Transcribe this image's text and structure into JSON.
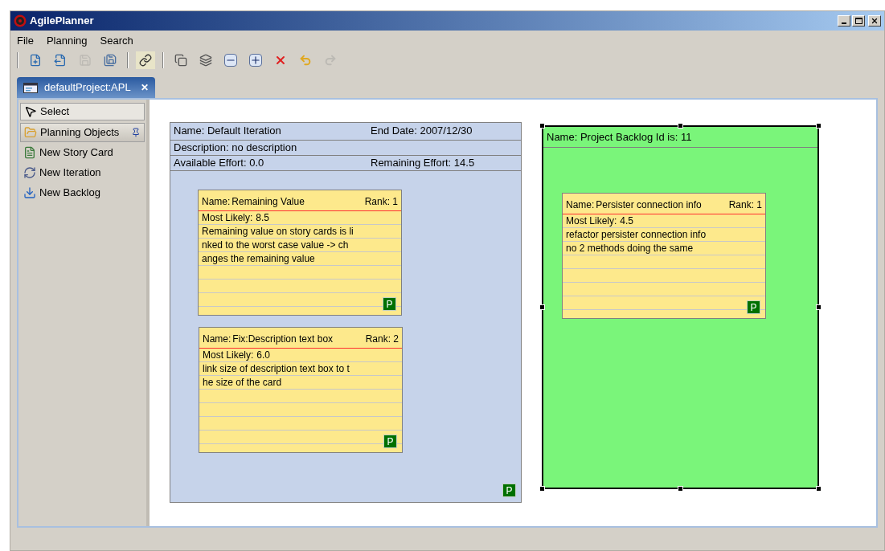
{
  "window": {
    "title": "AgilePlanner"
  },
  "menu": [
    {
      "label": "File"
    },
    {
      "label": "Planning"
    },
    {
      "label": "Search"
    }
  ],
  "toolbar": [
    {
      "kind": "separator"
    },
    {
      "kind": "new-card",
      "disabled": false
    },
    {
      "kind": "export",
      "disabled": false
    },
    {
      "kind": "save",
      "disabled": true
    },
    {
      "kind": "save-all",
      "disabled": false
    },
    {
      "kind": "separator"
    },
    {
      "kind": "link",
      "disabled": false
    },
    {
      "kind": "separator"
    },
    {
      "kind": "cards-in",
      "disabled": false
    },
    {
      "kind": "cards-out",
      "disabled": false
    },
    {
      "kind": "zoom-out",
      "disabled": false
    },
    {
      "kind": "zoom-in",
      "disabled": false
    },
    {
      "kind": "delete",
      "disabled": false
    },
    {
      "kind": "undo",
      "disabled": false
    },
    {
      "kind": "redo",
      "disabled": true
    }
  ],
  "editor_tab": {
    "label": "defaultProject:APL",
    "close": "✕",
    "selected": true
  },
  "palette": {
    "tool": {
      "label": "Select",
      "selected": true
    },
    "drawer": {
      "label": "Planning Objects",
      "pinned": true
    },
    "items": [
      {
        "kind": "story-card",
        "label": "New Story Card"
      },
      {
        "kind": "iteration",
        "label": "New Iteration"
      },
      {
        "kind": "backlog",
        "label": "New Backlog"
      }
    ]
  },
  "iteration": {
    "name": "Name: Default Iteration",
    "end_date": "End Date: 2007/12/30",
    "description": "Description: no description",
    "available": "Available Effort: 0.0",
    "remaining": "Remaining Effort: 14.5",
    "badge": "P",
    "cards": [
      {
        "name_label": "Name:",
        "name": "Remaining Value",
        "rank": "Rank: 1",
        "likely_label": "Most Likely:",
        "likely": "8.5",
        "lines": [
          "Remaining value on story cards is li",
          "nked to the worst case value -> ch",
          "anges the remaining value"
        ],
        "badge": "P"
      },
      {
        "name_label": "Name:",
        "name": "Fix:Description text box",
        "rank": "Rank: 2",
        "likely_label": "Most Likely:",
        "likely": "6.0",
        "lines": [
          "link size of description text box to t",
          "he size of the card"
        ],
        "badge": "P"
      }
    ]
  },
  "backlog": {
    "title": "Name: Project Backlog Id is: 11",
    "selected": true,
    "cards": [
      {
        "name_label": "Name:",
        "name": "Persister connection info",
        "rank": "Rank: 1",
        "likely_label": "Most Likely:",
        "likely": "4.5",
        "lines": [
          "refactor persister connection info",
          "no 2 methods doing the same"
        ],
        "badge": "P"
      }
    ]
  }
}
